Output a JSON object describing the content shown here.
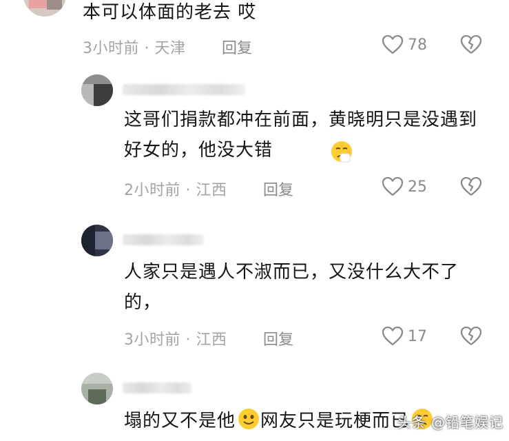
{
  "comments": [
    {
      "text": "本可以体面的老去 哎",
      "time": "3小时前",
      "location": "天津",
      "reply_label": "回复",
      "likes": "78"
    },
    {
      "text": "这哥们捐款都冲在前面，黄晓明只是没遇到好女的，他没大错",
      "time": "2小时前",
      "location": "江西",
      "reply_label": "回复",
      "likes": "25"
    },
    {
      "text": "人家只是遇人不淑而已，又没什么大不了的，",
      "time": "3小时前",
      "location": "江西",
      "reply_label": "回复",
      "likes": "17"
    },
    {
      "text_part1": "塌的又不是他",
      "text_part2": "网友只是玩梗而已"
    }
  ],
  "meta_separator": " · ",
  "watermark": "头条 @铅笔娱记",
  "icons": {
    "like": "heart-outline-icon",
    "dislike": "broken-heart-icon",
    "emoji_sad": "sad-face-emoji",
    "emoji_smile": "smile-face-emoji"
  }
}
